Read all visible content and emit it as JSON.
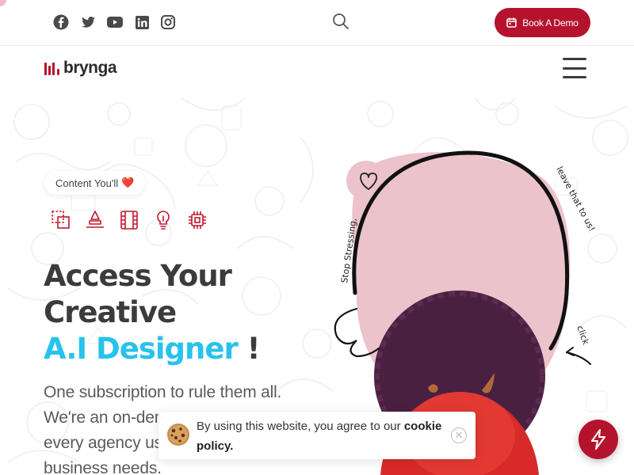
{
  "topbar": {
    "social_icons": [
      "facebook-icon",
      "twitter-icon",
      "youtube-icon",
      "linkedin-icon",
      "instagram-icon"
    ],
    "search_icon": "search-icon",
    "demo_button": {
      "label": "Book A Demo",
      "icon": "calendar-icon"
    }
  },
  "navbar": {
    "logo_text": "brynga",
    "menu_icon": "hamburger-menu-icon"
  },
  "hero": {
    "pill_label": "Content You'll",
    "pill_emoji": "❤️",
    "category_icons": [
      "crop-icon",
      "stamp-icon",
      "film-icon",
      "lightbulb-icon",
      "chip-icon"
    ],
    "headline_line1": "Access Your",
    "headline_line2": "Creative",
    "headline_accent": "A.I Designer",
    "headline_bang": "!",
    "lead_text": "One subscription to rule them all. We're an on-demand ... every agency us... business needs.",
    "lead_lines": [
      "One subscription to rule them all.",
      "We're an on-dem",
      "every agency us",
      "business needs."
    ],
    "doodle_text_left": "Stop Stressing,",
    "doodle_text_right": "leave that to us!",
    "doodle_text_click": "click"
  },
  "cookie_banner": {
    "text": "By using this website, you agree to our",
    "link": "cookie policy.",
    "close_icon": "close-icon"
  },
  "fab": {
    "icon": "lightning-icon"
  },
  "colors": {
    "brand": "#b5132d",
    "accent": "#27c3ec",
    "heading": "#3b3b3b",
    "blob": "#ecc2cb"
  }
}
